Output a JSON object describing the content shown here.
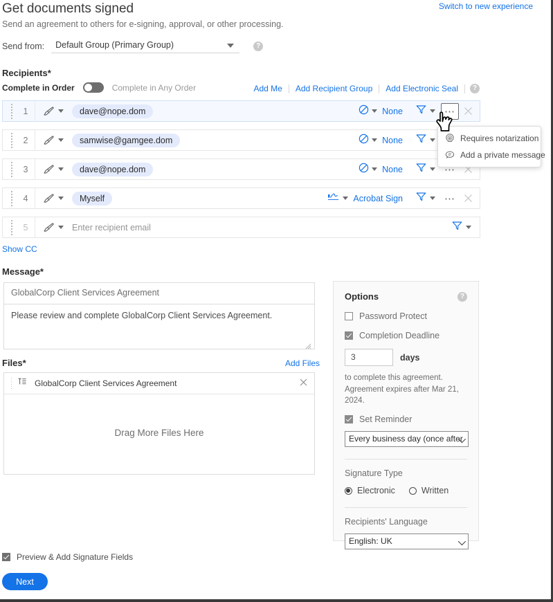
{
  "header": {
    "switch_link": "Switch to new experience",
    "title": "Get documents signed",
    "subtitle": "Send an agreement to others for e-signing, approval, or other processing.",
    "send_from_label": "Send from:",
    "send_from_value": "Default Group (Primary Group)",
    "help_glyph": "?"
  },
  "recipients": {
    "section_label": "Recipients",
    "required_mark": "*",
    "complete_in_order_label": "Complete in Order",
    "complete_in_any_order_label": "Complete in Any Order",
    "toggle_state": "off",
    "actions": {
      "add_me": "Add Me",
      "add_recipient_group": "Add Recipient Group",
      "add_electronic_seal": "Add Electronic Seal",
      "help_glyph": "?"
    },
    "rows": [
      {
        "number": "1",
        "email": "dave@nope.dom",
        "is_placeholder": false,
        "auth": "None",
        "auth_icon": "no-auth-icon",
        "active": true,
        "show_more": true,
        "show_close": true
      },
      {
        "number": "2",
        "email": "samwise@gamgee.dom",
        "is_placeholder": false,
        "auth": "None",
        "auth_icon": "no-auth-icon",
        "active": false,
        "show_more": true,
        "show_close": true
      },
      {
        "number": "3",
        "email": "dave@nope.dom",
        "is_placeholder": false,
        "auth": "None",
        "auth_icon": "no-auth-icon",
        "active": false,
        "show_more": true,
        "show_close": true
      },
      {
        "number": "4",
        "email": "Myself",
        "is_placeholder": false,
        "auth": "Acrobat Sign",
        "auth_icon": "acrobat-sign-icon",
        "active": false,
        "show_more": true,
        "show_close": true
      },
      {
        "number": "5",
        "email": "Enter recipient email",
        "is_placeholder": true,
        "auth": "",
        "auth_icon": "",
        "active": false,
        "show_more": false,
        "show_close": false
      }
    ],
    "more_menu": {
      "items": [
        {
          "label": "Requires notarization",
          "icon": "notary-seal-icon"
        },
        {
          "label": "Add a private message",
          "icon": "message-bubble-icon"
        }
      ]
    },
    "show_cc": "Show CC"
  },
  "message": {
    "section_label": "Message",
    "required_mark": "*",
    "subject_value": "GlobalCorp Client Services Agreement",
    "body_value": "Please review and complete GlobalCorp Client Services Agreement."
  },
  "files": {
    "section_label": "Files",
    "required_mark": "*",
    "add_files_label": "Add Files",
    "items": [
      {
        "name": "GlobalCorp Client Services Agreement"
      }
    ],
    "drop_hint": "Drag More Files Here"
  },
  "options": {
    "title": "Options",
    "help_glyph": "?",
    "password_protect": {
      "label": "Password Protect",
      "checked": false
    },
    "completion_deadline": {
      "label": "Completion Deadline",
      "checked": true
    },
    "days_value": "3",
    "days_word": "days",
    "note_line1": "to complete this agreement.",
    "note_line2": "Agreement expires after Mar 21, 2024.",
    "set_reminder": {
      "label": "Set Reminder",
      "checked": true
    },
    "reminder_value": "Every business day (once after",
    "signature_type_label": "Signature Type",
    "signature_options": [
      {
        "label": "Electronic",
        "selected": true
      },
      {
        "label": "Written",
        "selected": false
      }
    ],
    "language_label": "Recipients' Language",
    "language_value": "English: UK"
  },
  "footer": {
    "preview_label": "Preview & Add Signature Fields",
    "preview_checked": true,
    "next_label": "Next"
  },
  "colors": {
    "accent_blue": "#1473e6",
    "pill_blue": "#e3eafc",
    "active_row_blue": "#f5f9ff",
    "text_dark": "#2c2c2c",
    "text_muted": "#6e6e6e"
  }
}
